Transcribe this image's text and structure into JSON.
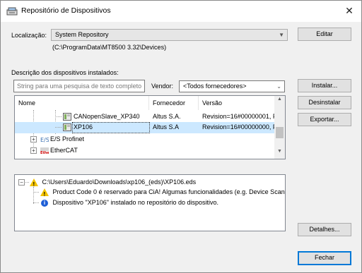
{
  "window": {
    "title": "Repositório de Dispositivos",
    "close_glyph": "✕"
  },
  "location": {
    "label": "Localização:",
    "selected": "System Repository",
    "path": "(C:\\ProgramData\\MT8500 3.32\\Devices)",
    "edit_button": "Editar"
  },
  "installed": {
    "label": "Descrição dos dispositivos instalados:",
    "search_placeholder": "String para uma pesquisa de texto completo",
    "vendor_label": "Vendor:",
    "vendor_selected": "<Todos fornecedores>"
  },
  "buttons": {
    "install": "Instalar...",
    "uninstall": "Desinstalar",
    "export": "Exportar...",
    "details": "Detalhes...",
    "close": "Fechar"
  },
  "tree": {
    "columns": [
      "Nome",
      "Fornecedor",
      "Versão"
    ],
    "rows": [
      {
        "name": "CANopenSlave_XP340",
        "vendor": "Altus S.A.",
        "version": "Revision=16#00000001, F",
        "selected": false
      },
      {
        "name": "XP106",
        "vendor": "Altus S.A",
        "version": "Revision=16#00000000, F",
        "selected": true
      },
      {
        "name": "E/S Profinet",
        "vendor": "",
        "version": "",
        "selected": false
      },
      {
        "name": "EtherCAT",
        "vendor": "",
        "version": "",
        "selected": false
      }
    ]
  },
  "log": {
    "file": "C:\\Users\\Eduardo\\Downloads\\xp106_(eds)\\XP106.eds",
    "warning": "Product Code 0 é reservado para CiA! Algumas funcionalidades (e.g. Device Scan...",
    "info": "Dispositivo \"XP106\" instalado no repositório do dispositivo."
  },
  "icons": {
    "app": "device-repository-icon",
    "warning": "warning-icon",
    "info": "info-icon"
  },
  "colors": {
    "selection": "#cce8ff",
    "default_button_border": "#0078d7",
    "warning": "#f2c200",
    "info": "#1f5fd6"
  }
}
